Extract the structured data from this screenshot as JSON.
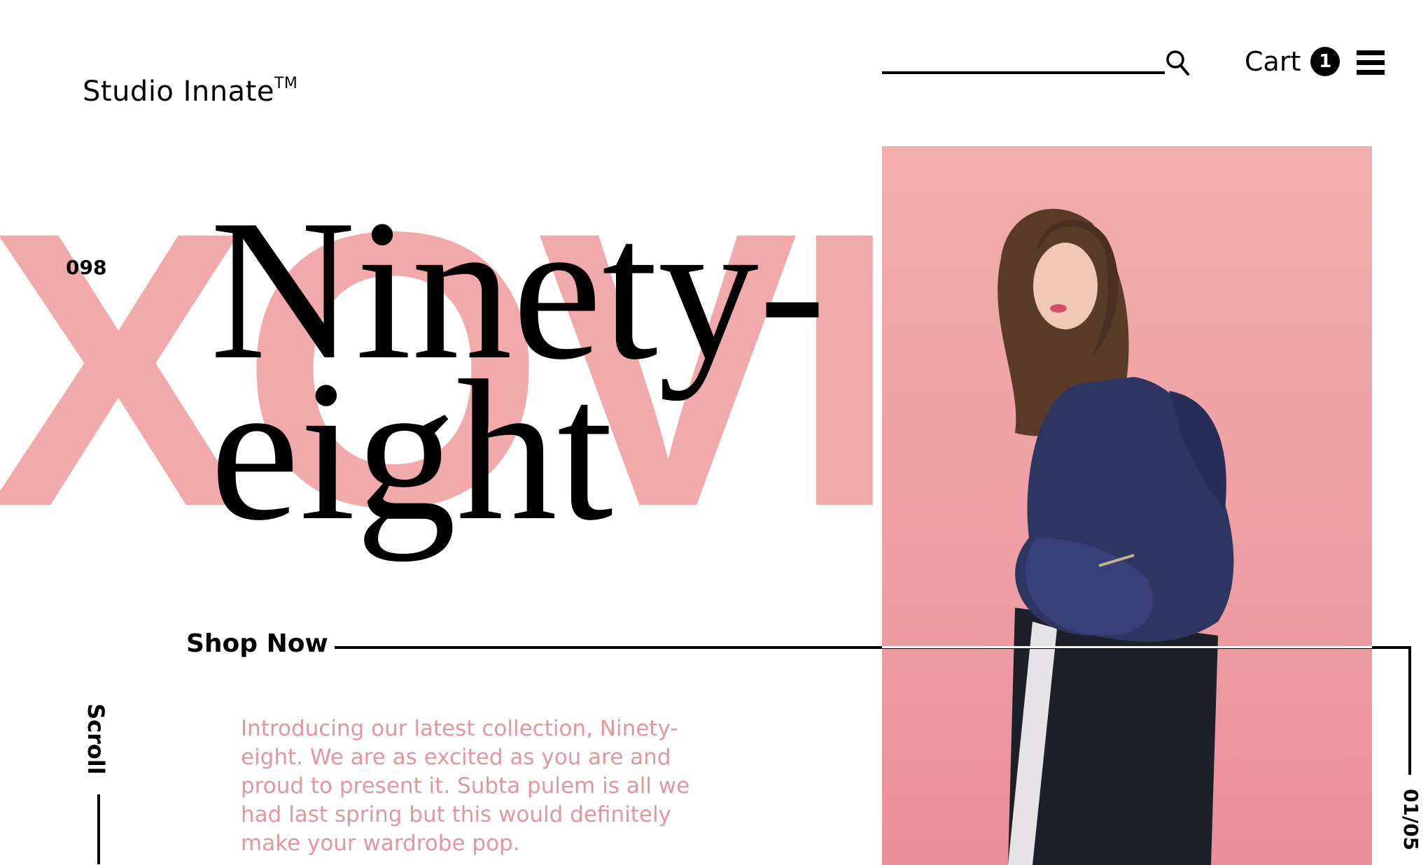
{
  "header": {
    "brand": "Studio Innate",
    "brand_mark": "TM",
    "search_icon": "search-icon",
    "cart_label": "Cart",
    "cart_count": "1",
    "menu_icon": "hamburger-menu-icon"
  },
  "hero": {
    "background_word": "XOVI",
    "number": "098",
    "headline_line1": "Ninety-",
    "headline_line2": "eight",
    "cta_label": "Shop Now",
    "description": "Introducing our latest collection, Ninety-eight. We are as excited as you are and proud to present it. Subta pulem is all we had last spring but this would definitely make your wardrobe pop.",
    "image_alt": "Model in navy puffer jacket and track pants against pink wall"
  },
  "footer": {
    "scroll_label": "Scroll",
    "slide_counter": "01/05"
  },
  "colors": {
    "accent_pink": "#f2a9ab",
    "text_pink": "#e2979c",
    "hero_bg": "#f0a6a8",
    "jacket": "#2d3561"
  }
}
